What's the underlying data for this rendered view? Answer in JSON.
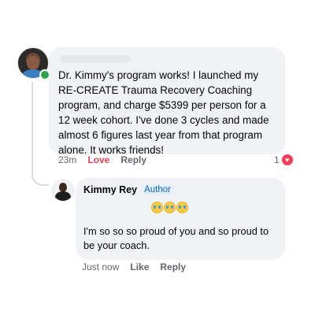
{
  "comment": {
    "text": "Dr. Kimmy's program works! I launched my RE-CREATE Trauma Recovery Coaching program, and charge $5399 per person for a 12 week cohort. I've done 3 cycles and made almost 6 figures last year from that program alone. It works friends!",
    "time": "23m",
    "love_label": "Love",
    "reply_label": "Reply",
    "reaction_count": "1",
    "reaction_icon": "heart-icon",
    "colors": {
      "bubble": "#f0f2f5",
      "love": "#f33e58",
      "online": "#31a24c",
      "meta": "#65676b"
    }
  },
  "reply": {
    "name": "Kimmy Rey",
    "badge": "Author",
    "emoji_icons": [
      "crying-face-emoji",
      "crying-face-emoji",
      "crying-face-emoji"
    ],
    "text": "I'm so so so proud of you and so proud to be your coach.",
    "time": "Just now",
    "like_label": "Like",
    "reply_label": "Reply",
    "colors": {
      "badge": "#0a66c2",
      "badge_bg": "#e7f0fb"
    }
  }
}
